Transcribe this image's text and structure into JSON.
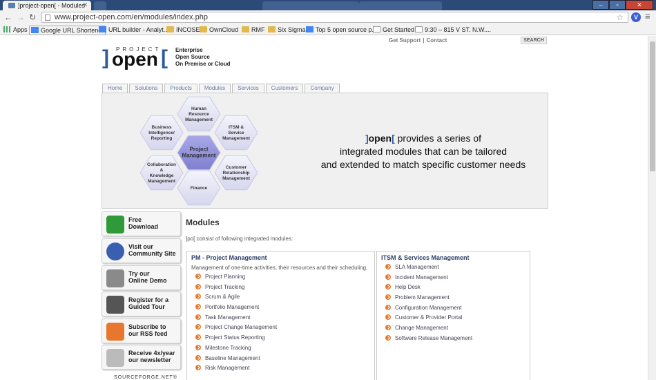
{
  "browser": {
    "tab_title": "]project-open[ - Modules",
    "url": "www.project-open.com/en/modules/index.php",
    "bookmarks": [
      {
        "label": "Apps",
        "icon": "apps-icon"
      },
      {
        "label": "Google URL Shortener",
        "icon": "google-icon"
      },
      {
        "label": "URL builder - Analyt...",
        "icon": "google-icon"
      },
      {
        "label": "INCOSE",
        "icon": "folder-icon"
      },
      {
        "label": "OwnCloud",
        "icon": "folder-icon"
      },
      {
        "label": "RMF",
        "icon": "folder-icon"
      },
      {
        "label": "Six Sigma",
        "icon": "folder-icon"
      },
      {
        "label": "Top 5 open source p...",
        "icon": "google-icon"
      },
      {
        "label": "Get Started",
        "icon": "page-icon"
      },
      {
        "label": "9:30 – 815 V ST. N.W....",
        "icon": "page-icon"
      }
    ]
  },
  "header": {
    "get_support": "Get Support",
    "contact": "Contact",
    "search": "SEARCH",
    "logo_project": "PROJECT",
    "logo_open": "open",
    "tagline": [
      "Enterprise",
      "Open Source",
      "On Premise or Cloud"
    ]
  },
  "nav": [
    "Home",
    "Solutions",
    "Products",
    "Modules",
    "Services",
    "Customers",
    "Company"
  ],
  "banner": {
    "hexes": {
      "hr": [
        "Human",
        "Resource",
        "Management"
      ],
      "itsm": [
        "ITSM &",
        "Service",
        "Management"
      ],
      "bi": [
        "Business",
        "Intelligence/",
        "Reporting"
      ],
      "pm": [
        "Project",
        "Management"
      ],
      "ck": [
        "Collaboration",
        "&",
        "Knowledge",
        "Management"
      ],
      "crm": [
        "Customer",
        "Relationship",
        "Management"
      ],
      "fin": [
        "Finance"
      ]
    },
    "text_line1": "provides a series of",
    "text_line2": "integrated modules that can be tailored",
    "text_line3": "and extended to match specific customer needs"
  },
  "sidebar": [
    {
      "label1": "Free",
      "label2": "Download",
      "icon": "download-icon"
    },
    {
      "label1": "Visit our",
      "label2": "Community Site",
      "icon": "community-icon"
    },
    {
      "label1": "Try our",
      "label2": "Online Demo",
      "icon": "demo-icon"
    },
    {
      "label1": "Register for a",
      "label2": "Guided Tour",
      "icon": "tour-icon"
    },
    {
      "label1": "Subscribe to",
      "label2": "our RSS feed",
      "icon": "rss-icon"
    },
    {
      "label1": "Receive 4x/year",
      "label2": "our newsletter",
      "icon": "newsletter-icon"
    }
  ],
  "sourceforge": "SOURCEFORGE.NET®",
  "main": {
    "title": "Modules",
    "intro": "]po[ consist of following integrated modules:",
    "pm_box": {
      "title": "PM - Project Management",
      "desc": "Management of one-time activities, their resources and their scheduling.",
      "items": [
        "Project Planning",
        "Project Tracking",
        "Scrum & Agile",
        "Portfolio Management",
        "Task Management",
        "Project Change Management",
        "Project Status Reporting",
        "Milestone Tracking",
        "Baseline Management",
        "Risk Management"
      ]
    },
    "itsm_box": {
      "title": "ITSM & Services Management",
      "items": [
        "SLA Management",
        "Incident Management",
        "Help Desk",
        "Problem Management",
        "Configuration Management",
        "Customer & Provider Portal",
        "Change Management",
        "Software Release Management"
      ]
    }
  },
  "colors": {
    "accent_blue": "#2d5b9c",
    "bullet_orange": "#e8772e",
    "hex_center": "#8e8ed8"
  }
}
